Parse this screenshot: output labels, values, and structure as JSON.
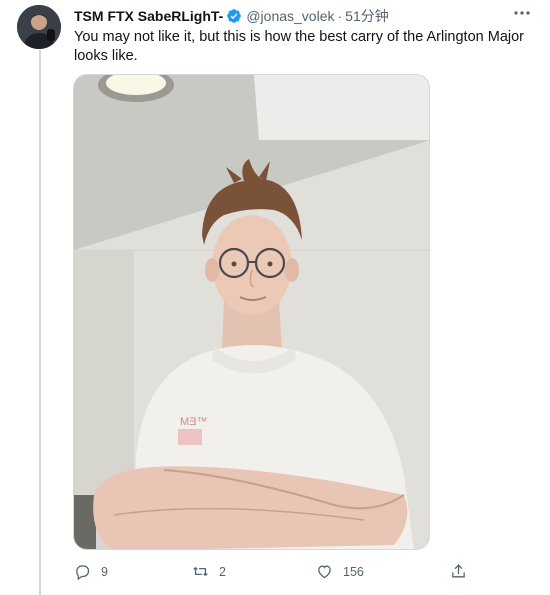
{
  "tweet": {
    "author_name": "TSM FTX SabeRLighT-",
    "handle": "@jonas_volek",
    "separator": "·",
    "time": "51分钟",
    "text": "You may not like it, but this is how the best carry of the Arlington Major looks like.",
    "verified": true
  },
  "actions": {
    "replies": "9",
    "retweets": "2",
    "likes": "156"
  },
  "colors": {
    "verified_blue": "#1d9bf0",
    "muted_text": "#536471",
    "thread_line": "#cfd9de"
  },
  "icons": [
    "more-icon",
    "verified-icon",
    "reply-icon",
    "retweet-icon",
    "like-icon",
    "share-icon"
  ]
}
